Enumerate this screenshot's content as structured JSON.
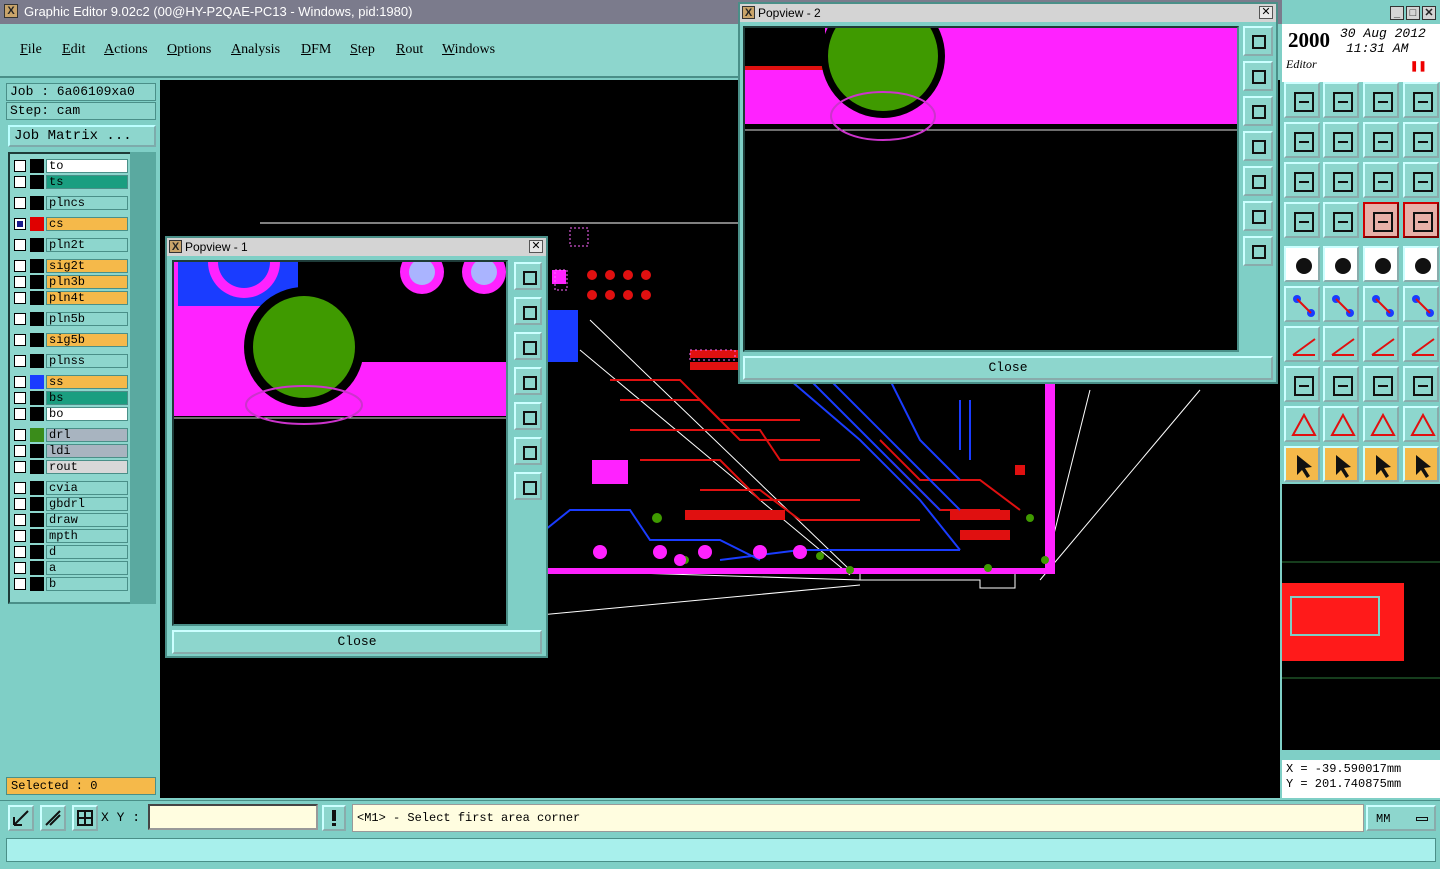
{
  "app": {
    "title": "Graphic Editor 9.02c2 (00@HY-P2QAE-PC13 - Windows, pid:1980)"
  },
  "menu": [
    "File",
    "Edit",
    "Actions",
    "Options",
    "Analysis",
    "DFM",
    "Step",
    "Rout",
    "Windows"
  ],
  "job": {
    "job_label": "Job : 6a06109xa0",
    "step_label": "Step: cam",
    "matrix_button": "Job Matrix ..."
  },
  "layers": [
    {
      "name": "to",
      "color": "#ffffff",
      "swatch": "#000000",
      "checked": false
    },
    {
      "name": "ts",
      "color": "#1a9e80",
      "swatch": "#000000",
      "checked": false
    },
    {
      "name": "plncs",
      "color": "#8dd6cd",
      "swatch": "#000000",
      "checked": false
    },
    {
      "name": "cs",
      "color": "#f5b94a",
      "swatch": "#e00000",
      "checked": true
    },
    {
      "name": "pln2t",
      "color": "#8dd6cd",
      "swatch": "#000000",
      "checked": false
    },
    {
      "name": "sig2t",
      "color": "#f5b94a",
      "swatch": "#000000",
      "checked": false
    },
    {
      "name": "pln3b",
      "color": "#f5b94a",
      "swatch": "#000000",
      "checked": false
    },
    {
      "name": "pln4t",
      "color": "#f5b94a",
      "swatch": "#000000",
      "checked": false
    },
    {
      "name": "pln5b",
      "color": "#8dd6cd",
      "swatch": "#000000",
      "checked": false
    },
    {
      "name": "sig5b",
      "color": "#f5b94a",
      "swatch": "#000000",
      "checked": false
    },
    {
      "name": "plnss",
      "color": "#8dd6cd",
      "swatch": "#000000",
      "checked": false
    },
    {
      "name": "ss",
      "color": "#f5b94a",
      "swatch": "#1a3cff",
      "checked": false
    },
    {
      "name": "bs",
      "color": "#1a9e80",
      "swatch": "#000000",
      "checked": false
    },
    {
      "name": "bo",
      "color": "#ffffff",
      "swatch": "#000000",
      "checked": false
    },
    {
      "name": "drl",
      "color": "#a8b4c0",
      "swatch": "#3a8c1a",
      "checked": false
    },
    {
      "name": "ldi",
      "color": "#a8b4c0",
      "swatch": "#000000",
      "checked": false
    },
    {
      "name": "rout",
      "color": "#d8d8d8",
      "swatch": "#000000",
      "checked": false
    },
    {
      "name": "cvia",
      "color": "#8dd6cd",
      "swatch": "#000000",
      "checked": false
    },
    {
      "name": "gbdrl",
      "color": "#8dd6cd",
      "swatch": "#000000",
      "checked": false
    },
    {
      "name": "draw",
      "color": "#8dd6cd",
      "swatch": "#000000",
      "checked": false
    },
    {
      "name": "mpth",
      "color": "#8dd6cd",
      "swatch": "#000000",
      "checked": false
    },
    {
      "name": "d",
      "color": "#8dd6cd",
      "swatch": "#000000",
      "checked": false
    },
    {
      "name": "a",
      "color": "#8dd6cd",
      "swatch": "#000000",
      "checked": false
    },
    {
      "name": "b",
      "color": "#8dd6cd",
      "swatch": "#000000",
      "checked": false
    }
  ],
  "selected": "Selected : 0",
  "popview1": {
    "title": "Popview - 1",
    "close": "Close"
  },
  "popview2": {
    "title": "Popview - 2",
    "close": "Close"
  },
  "clock": {
    "year": "2000",
    "date": "30 Aug 2012",
    "time": "11:31 AM",
    "mode": "Editor"
  },
  "coords": {
    "x": "X = -39.590017mm",
    "y": "Y = 201.740875mm"
  },
  "status": {
    "xy_label": "X Y :",
    "xy_value": "",
    "prompt": "<M1> - Select first area corner",
    "units": "MM"
  },
  "colors": {
    "panel": "#7fcfc6",
    "copper": "#ff22ff",
    "pad": "#3f9a00",
    "trace_red": "#e01010",
    "trace_blue": "#1a3cff"
  }
}
